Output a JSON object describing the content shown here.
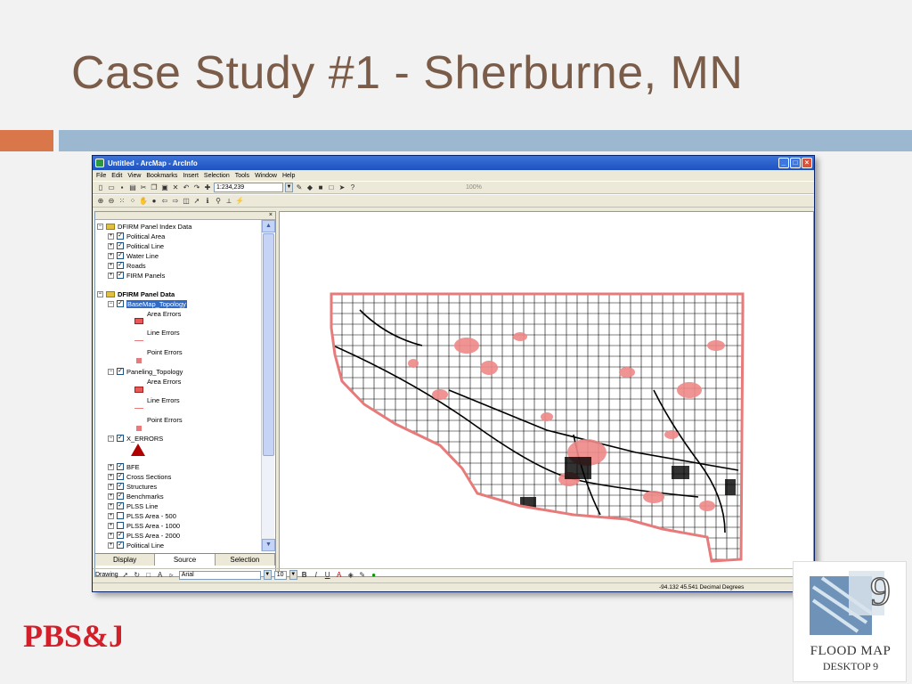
{
  "slide": {
    "title": "Case Study #1 - Sherburne, MN",
    "accent_colors": {
      "title": "#7a5c49",
      "orange_bar": "#d9774a",
      "blue_bar": "#9cb8d0"
    }
  },
  "window": {
    "title": "Untitled - ArcMap - ArcInfo",
    "menu": [
      "File",
      "Edit",
      "View",
      "Bookmarks",
      "Insert",
      "Selection",
      "Tools",
      "Window",
      "Help"
    ],
    "scale": "1:234,239",
    "zoom_percent": "100%"
  },
  "toc": {
    "groups": [
      {
        "label": "DFIRM Panel Index Data",
        "layers": [
          "Political Area",
          "Political Line",
          "Water Line",
          "Roads",
          "FIRM Panels"
        ]
      },
      {
        "label": "DFIRM Panel Data"
      }
    ],
    "basemap_topology": {
      "label": "BaseMap_Topology",
      "legend": [
        "Area Errors",
        "Line Errors",
        "Point Errors"
      ]
    },
    "paneling_topology": {
      "label": "Paneling_Topology",
      "legend": [
        "Area Errors",
        "Line Errors",
        "Point Errors"
      ]
    },
    "x_errors": "X_ERRORS",
    "more_layers": [
      "BFE",
      "Cross Sections",
      "Structures",
      "Benchmarks",
      "PLSS Line",
      "PLSS Area - 500",
      "PLSS Area - 1000",
      "PLSS Area - 2000",
      "Political Line"
    ],
    "tabs": [
      "Display",
      "Source",
      "Selection"
    ]
  },
  "drawing_toolbar": {
    "label": "Drawing",
    "font": "Arial",
    "font_size": "10"
  },
  "status_bar": {
    "coords": "-94.132  45.541 Decimal Degrees"
  },
  "logos": {
    "pbsj": "PBS&J",
    "fmd_line1": "FLOOD MAP",
    "fmd_line2": "DESKTOP 9",
    "fmd_badge": "9"
  }
}
